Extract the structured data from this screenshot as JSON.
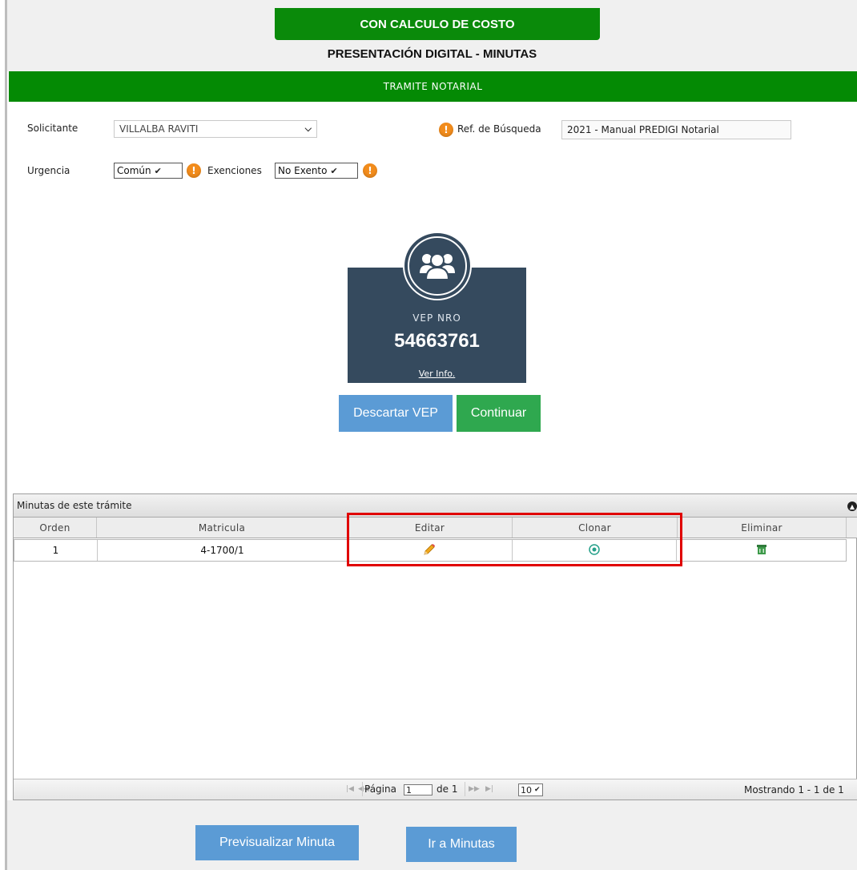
{
  "header": {
    "top_button_label": "CON CALCULO DE COSTO",
    "subtitle": "PRESENTACIÓN DIGITAL - MINUTAS",
    "bar_title": "TRAMITE NOTARIAL"
  },
  "form": {
    "solicitante_label": "Solicitante",
    "solicitante_value": "VILLALBA RAVITI",
    "ref_label": "Ref. de Búsqueda",
    "ref_value": "2021 - Manual PREDIGI Notarial",
    "urgencia_label": "Urgencia",
    "urgencia_value": "Común",
    "exenciones_label": "Exenciones",
    "exenciones_value": "No Exento"
  },
  "vep": {
    "label": "VEP NRO",
    "number": "54663761",
    "info_link": "Ver Info.",
    "discard_button": "Descartar VEP",
    "continue_button": "Continuar"
  },
  "grid": {
    "caption": "Minutas de este trámite",
    "columns": [
      "Orden",
      "Matricula",
      "Editar",
      "Clonar",
      "Eliminar"
    ],
    "rows": [
      {
        "orden": "1",
        "matricula": "4-1700/1"
      }
    ],
    "pager": {
      "page_label": "Página",
      "page_value": "1",
      "of_label": "de 1",
      "page_size": "10",
      "summary": "Mostrando 1 - 1 de 1"
    }
  },
  "footer": {
    "preview_button": "Previsualizar Minuta",
    "goto_button": "Ir a Minutas"
  },
  "colors": {
    "brand_green": "#048a04",
    "card_bg": "#354a5e",
    "button_blue": "#5b9bd5",
    "button_green": "#2fa84f",
    "highlight_red": "#e00000",
    "warning_orange": "#f28c1c"
  }
}
